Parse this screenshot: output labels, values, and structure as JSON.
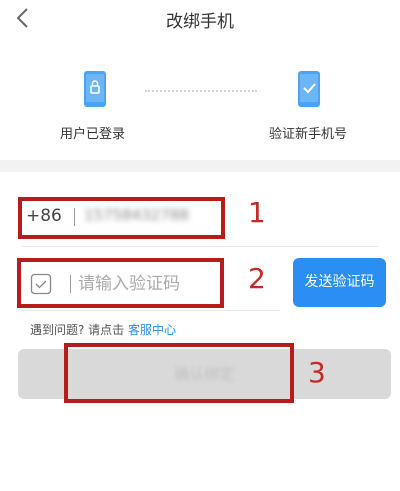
{
  "header": {
    "title": "改绑手机"
  },
  "steps": [
    {
      "label": "用户已登录"
    },
    {
      "label": "验证新手机号"
    }
  ],
  "phone": {
    "prefix": "+86",
    "value": "15758432788"
  },
  "code": {
    "placeholder": "请输入验证码",
    "send_label": "发送验证码"
  },
  "help": {
    "text": "遇到问题? 请点击",
    "link": "客服中心"
  },
  "confirm": {
    "label": "确认绑定"
  },
  "annotations": [
    "1",
    "2",
    "3"
  ],
  "colors": {
    "accent": "#2a8ef2",
    "annotation": "#b71c1c",
    "disabled": "#d9d9d9"
  }
}
